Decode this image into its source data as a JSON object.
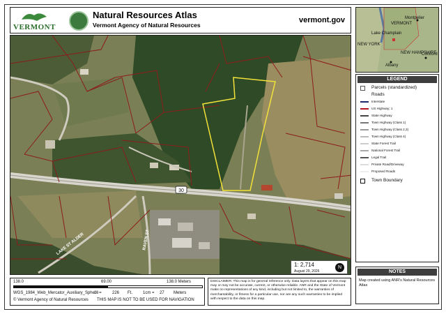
{
  "header": {
    "logo_word": "VERMONT",
    "title": "Natural Resources Atlas",
    "subtitle": "Vermont Agency of Natural Resources",
    "site": "vermont.gov"
  },
  "map": {
    "route_shield": "30",
    "road_labels": [
      "LAKE ST ALDER",
      "RAVEN ST"
    ]
  },
  "inset": {
    "labels": [
      "VERMONT",
      "Lake Champlain",
      "Montpelier",
      "NEW YORK",
      "NEW HAMPSHIRE",
      "Albany",
      "Concord"
    ]
  },
  "legend": {
    "title": "LEGEND",
    "parcels": "Parcels (standardized)",
    "roads": "Roads",
    "items": [
      {
        "label": "Interstate",
        "color": "#1a2a6c"
      },
      {
        "label": "US Highway; 1",
        "color": "#b0171f"
      },
      {
        "label": "State Highway",
        "color": "#444444"
      },
      {
        "label": "Town Highway (Class 1)",
        "color": "#777777"
      },
      {
        "label": "Town Highway (Class 2,3)",
        "color": "#999999"
      },
      {
        "label": "Town Highway (Class 4)",
        "color": "#bbbbbb"
      },
      {
        "label": "State Forest Trail",
        "color": "#cccccc"
      },
      {
        "label": "National Forest Trail",
        "color": "#aaaaaa"
      },
      {
        "label": "Legal Trail",
        "color": "#555555"
      },
      {
        "label": "Private Road/Driveway",
        "color": "#dddddd"
      },
      {
        "label": "Proposed Roads",
        "color": "#eeeeee"
      }
    ],
    "town_boundary": "Town Boundary"
  },
  "notes": {
    "title": "NOTES",
    "text": "Map created using ANR's Natural Resources Atlas"
  },
  "scale": {
    "ratio": "1: 2,714",
    "date": "August 29, 2026",
    "north": "N",
    "bar_left": "138.0",
    "bar_mid": "69.00",
    "bar_right": "138.0 Meters",
    "projection": "WGS_1984_Web_Mercator_Auxiliary_Sphere",
    "inch": "1\" =",
    "inch_value": "226",
    "inch_unit": "Ft.",
    "cm": "1cm =",
    "cm_value": "27",
    "cm_unit": "Meters",
    "copyright": "© Vermont Agency of Natural Resources",
    "nav_warning": "THIS MAP IS NOT TO BE USED FOR NAVIGATION"
  },
  "disclaimer": "DISCLAIMER: This map is for general reference only. Data layers that appear on this map may or may not be accurate, current, or otherwise reliable. ANR and the State of Vermont make no representations of any kind, including but not limited to, the warranties of merchantability, or fitness for a particular use, nor are any such warranties to be implied with respect to the data on this map.",
  "colors": {
    "parcel_line": "#8b1c1c",
    "highlight": "#f2e23a",
    "forest": "#2f4a26",
    "field": "#8a8458",
    "road": "#c9c6b8"
  }
}
